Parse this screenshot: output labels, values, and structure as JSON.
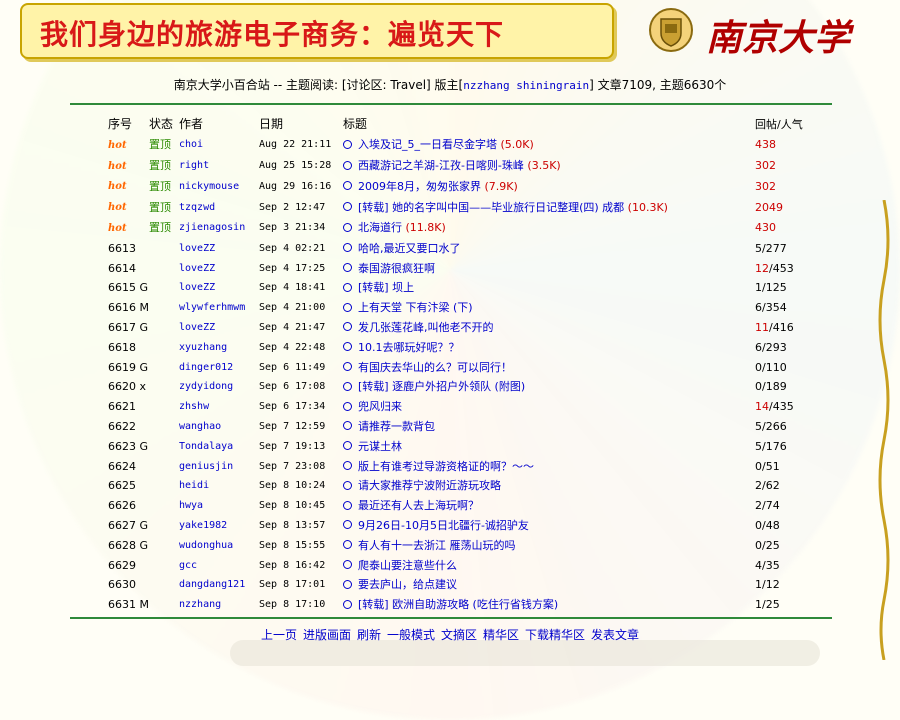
{
  "slide": {
    "title": "我们身边的旅游电子商务：遍览天下",
    "university_name": "南京大学"
  },
  "header": {
    "prefix": "南京大学小百合站 -- 主题阅读: [讨论区: Travel] 版主[",
    "moderators": "nzzhang shiningrain",
    "suffix": "] 文章7109, 主题6630个"
  },
  "columns": {
    "seq": "序号",
    "status": "状态",
    "author": "作者",
    "date": "日期",
    "title": "标题",
    "replies": "回帖/人气"
  },
  "rows": [
    {
      "seq": "hot",
      "status": "置顶",
      "author": "choi",
      "date": "Aug 22 21:11",
      "title": "入埃及记_5_一日看尽金字塔",
      "size": "(5.0K)",
      "replies": "438",
      "replies_rest": ""
    },
    {
      "seq": "hot",
      "status": "置顶",
      "author": "right",
      "date": "Aug 25 15:28",
      "title": "西藏游记之羊湖-江孜-日喀则-珠峰",
      "size": "(3.5K)",
      "replies": "302",
      "replies_rest": ""
    },
    {
      "seq": "hot",
      "status": "置顶",
      "author": "nickymouse",
      "date": "Aug 29 16:16",
      "title": "2009年8月，匆匆张家界",
      "size": "(7.9K)",
      "replies": "302",
      "replies_rest": ""
    },
    {
      "seq": "hot",
      "status": "置顶",
      "author": "tzqzwd",
      "date": "Sep 2 12:47",
      "title": "[转载] 她的名字叫中国——毕业旅行日记整理(四) 成都",
      "size": "(10.3K)",
      "replies": "2049",
      "replies_rest": ""
    },
    {
      "seq": "hot",
      "status": "置顶",
      "author": "zjienagosin",
      "date": "Sep 3 21:34",
      "title": "北海道行",
      "size": "(11.8K)",
      "replies": "430",
      "replies_rest": ""
    },
    {
      "seq": "6613",
      "status": "",
      "author": "loveZZ",
      "date": "Sep 4 02:21",
      "title": "哈哈,最近又要口水了",
      "size": "",
      "replies": "5",
      "replies_rest": "/277"
    },
    {
      "seq": "6614",
      "status": "",
      "author": "loveZZ",
      "date": "Sep 4 17:25",
      "title": "泰国游很疯狂啊",
      "size": "",
      "replies": "12",
      "replies_rest": "/453"
    },
    {
      "seq": "6615 G",
      "status": "",
      "author": "loveZZ",
      "date": "Sep 4 18:41",
      "title": "[转载] 坝上",
      "size": "",
      "replies": "1",
      "replies_rest": "/125"
    },
    {
      "seq": "6616 M",
      "status": "",
      "author": "wlywferhmwm",
      "date": "Sep 4 21:00",
      "title": "上有天堂 下有汴梁 (下)",
      "size": "",
      "replies": "6",
      "replies_rest": "/354"
    },
    {
      "seq": "6617 G",
      "status": "",
      "author": "loveZZ",
      "date": "Sep 4 21:47",
      "title": "发几张莲花峰,叫他老不开的",
      "size": "",
      "replies": "11",
      "replies_rest": "/416"
    },
    {
      "seq": "6618",
      "status": "",
      "author": "xyuzhang",
      "date": "Sep 4 22:48",
      "title": "10.1去哪玩好呢？？",
      "size": "",
      "replies": "6",
      "replies_rest": "/293"
    },
    {
      "seq": "6619 G",
      "status": "",
      "author": "dinger012",
      "date": "Sep 6 11:49",
      "title": "有国庆去华山的么？可以同行！",
      "size": "",
      "replies": "0",
      "replies_rest": "/110"
    },
    {
      "seq": "6620 x",
      "status": "",
      "author": "zydyidong",
      "date": "Sep 6 17:08",
      "title": "[转载] 逐鹿户外招户外领队 (附图)",
      "size": "",
      "replies": "0",
      "replies_rest": "/189"
    },
    {
      "seq": "6621",
      "status": "",
      "author": "zhshw",
      "date": "Sep 6 17:34",
      "title": "兜风归来",
      "size": "",
      "replies": "14",
      "replies_rest": "/435"
    },
    {
      "seq": "6622",
      "status": "",
      "author": "wanghao",
      "date": "Sep 7 12:59",
      "title": "请推荐一款背包",
      "size": "",
      "replies": "5",
      "replies_rest": "/266"
    },
    {
      "seq": "6623 G",
      "status": "",
      "author": "Tondalaya",
      "date": "Sep 7 19:13",
      "title": "元谋土林",
      "size": "",
      "replies": "5",
      "replies_rest": "/176"
    },
    {
      "seq": "6624",
      "status": "",
      "author": "geniusjin",
      "date": "Sep 7 23:08",
      "title": "版上有谁考过导游资格证的啊？～～",
      "size": "",
      "replies": "0",
      "replies_rest": "/51"
    },
    {
      "seq": "6625",
      "status": "",
      "author": "heidi",
      "date": "Sep 8 10:24",
      "title": "请大家推荐宁波附近游玩攻略",
      "size": "",
      "replies": "2",
      "replies_rest": "/62"
    },
    {
      "seq": "6626",
      "status": "",
      "author": "hwya",
      "date": "Sep 8 10:45",
      "title": "最近还有人去上海玩啊？",
      "size": "",
      "replies": "2",
      "replies_rest": "/74"
    },
    {
      "seq": "6627 G",
      "status": "",
      "author": "yake1982",
      "date": "Sep 8 13:57",
      "title": "9月26日-10月5日北疆行-诚招驴友",
      "size": "",
      "replies": "0",
      "replies_rest": "/48"
    },
    {
      "seq": "6628 G",
      "status": "",
      "author": "wudonghua",
      "date": "Sep 8 15:55",
      "title": "有人有十一去浙江 雁荡山玩的吗",
      "size": "",
      "replies": "0",
      "replies_rest": "/25"
    },
    {
      "seq": "6629",
      "status": "",
      "author": "gcc",
      "date": "Sep 8 16:42",
      "title": "爬泰山要注意些什么",
      "size": "",
      "replies": "4",
      "replies_rest": "/35"
    },
    {
      "seq": "6630",
      "status": "",
      "author": "dangdang121",
      "date": "Sep 8 17:01",
      "title": "要去庐山，给点建议",
      "size": "",
      "replies": "1",
      "replies_rest": "/12"
    },
    {
      "seq": "6631 M",
      "status": "",
      "author": "nzzhang",
      "date": "Sep 8 17:10",
      "title": "[转载] 欧洲自助游攻略 (吃住行省钱方案)",
      "size": "",
      "replies": "1",
      "replies_rest": "/25"
    }
  ],
  "footer_links": [
    "上一页",
    "进版画面",
    "刷新",
    "一般模式",
    "文摘区",
    "精华区",
    "下载精华区",
    "发表文章"
  ],
  "colors": {
    "link": "#0000cc",
    "hot": "#ff6600",
    "pinned": "#2b8a00",
    "highlight": "#cc0000",
    "rule": "#2f8a3a",
    "title": "#d81818"
  }
}
